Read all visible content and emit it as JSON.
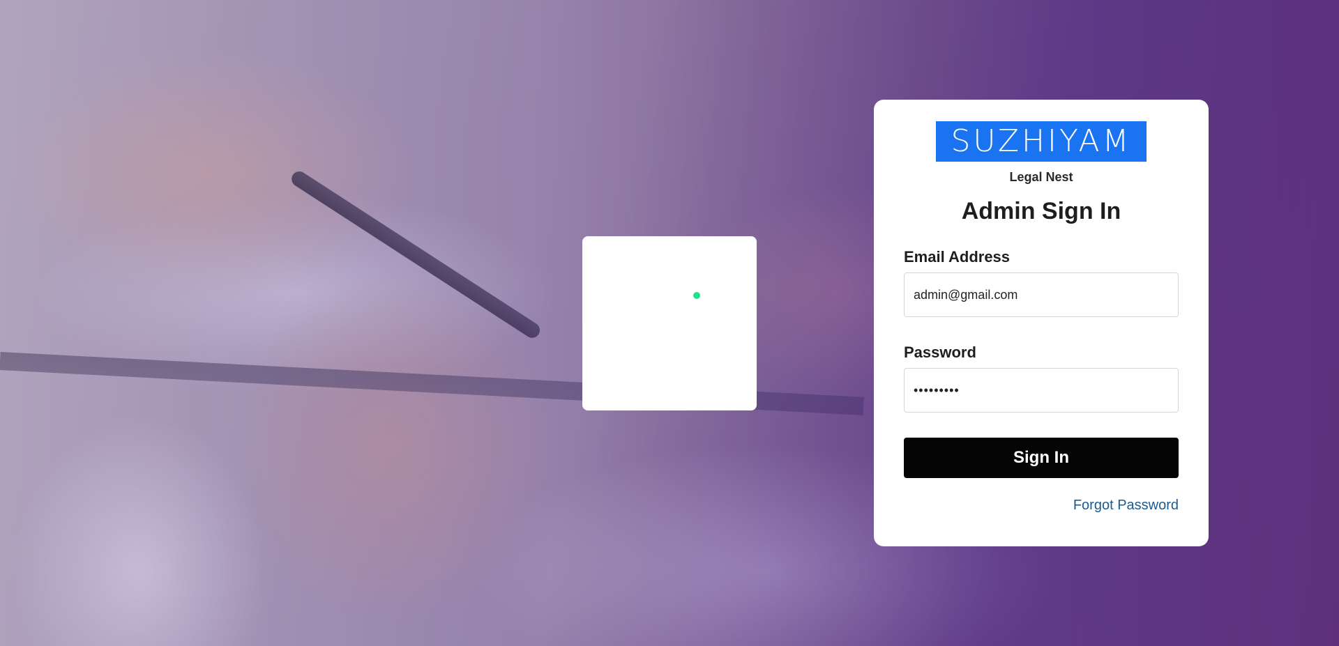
{
  "brand": {
    "logo_text": "SUZHIYAM",
    "subtitle": "Legal Nest"
  },
  "page": {
    "title": "Admin Sign In"
  },
  "form": {
    "email_label": "Email Address",
    "email_value": "admin@gmail.com",
    "password_label": "Password",
    "password_value": "•••••••••",
    "submit_label": "Sign In",
    "forgot_label": "Forgot Password"
  },
  "colors": {
    "logo_bg": "#1a73f0",
    "button_bg": "#050505",
    "link": "#1d5a8c",
    "loader_dot": "#22e085"
  }
}
